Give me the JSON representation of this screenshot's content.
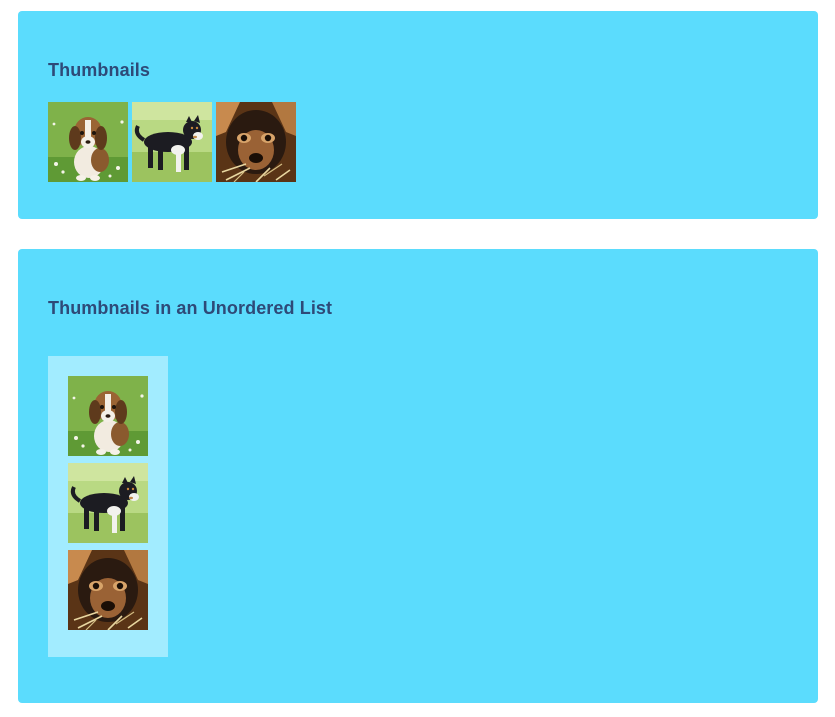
{
  "sections": [
    {
      "title": "Thumbnails",
      "layout": "row",
      "images": [
        {
          "icon": "beagle-puppy-photo",
          "alt": "beagle puppy sitting in grass"
        },
        {
          "icon": "black-dog-photo",
          "alt": "black and white dog standing in grass"
        },
        {
          "icon": "dog-closeup-photo",
          "alt": "close-up of a dog's face"
        }
      ]
    },
    {
      "title": "Thumbnails in an Unordered List",
      "layout": "list",
      "images": [
        {
          "icon": "beagle-puppy-photo",
          "alt": "beagle puppy sitting in grass"
        },
        {
          "icon": "black-dog-photo",
          "alt": "black and white dog standing in grass"
        },
        {
          "icon": "dog-closeup-photo",
          "alt": "close-up of a dog's face"
        }
      ]
    }
  ],
  "colors": {
    "panel_bg": "#5bdcfd",
    "list_bg": "#a2ecff",
    "title_text": "#2e4a78"
  }
}
